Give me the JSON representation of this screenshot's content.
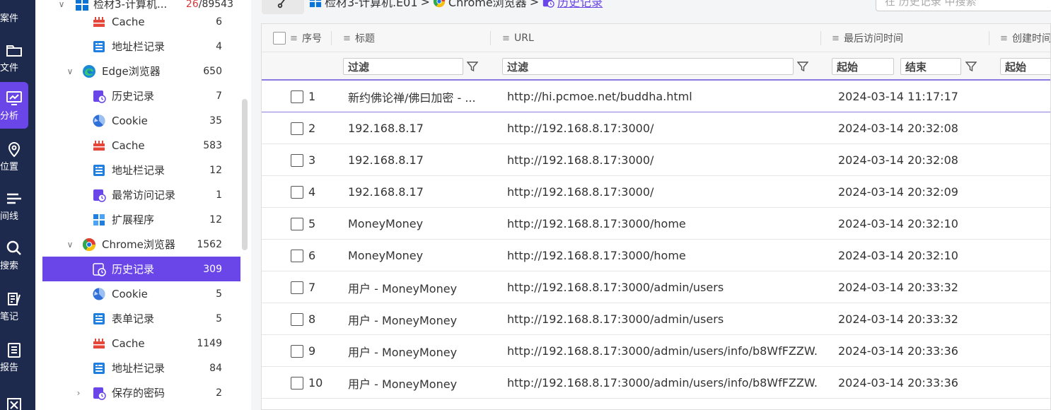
{
  "rail": {
    "items": [
      {
        "label": "案件",
        "icon": "case-icon"
      },
      {
        "label": "文件",
        "icon": "folder-icon"
      },
      {
        "label": "分析",
        "icon": "analysis-icon",
        "active": true
      },
      {
        "label": "位置",
        "icon": "location-icon"
      },
      {
        "label": "间线",
        "icon": "timeline-icon"
      },
      {
        "label": "搜索",
        "icon": "search-icon"
      },
      {
        "label": "笔记",
        "icon": "note-icon"
      },
      {
        "label": "报告",
        "icon": "report-icon"
      },
      {
        "label": "",
        "icon": "tool-icon"
      }
    ]
  },
  "tree": {
    "root": {
      "label": "检材3-计算机...",
      "count_a": "26",
      "count_b": "/89543"
    },
    "items": [
      {
        "label": "Cache",
        "count": "6",
        "icon": "cache-icon",
        "level": 2
      },
      {
        "label": "地址栏记录",
        "count": "4",
        "icon": "addressbar-icon",
        "level": 2
      },
      {
        "label": "Edge浏览器",
        "count": "650",
        "icon": "edge-icon",
        "level": 1,
        "expanded": true
      },
      {
        "label": "历史记录",
        "count": "7",
        "icon": "history-icon",
        "level": 2
      },
      {
        "label": "Cookie",
        "count": "35",
        "icon": "cookie-icon",
        "level": 2
      },
      {
        "label": "Cache",
        "count": "583",
        "icon": "cache-icon",
        "level": 2
      },
      {
        "label": "地址栏记录",
        "count": "12",
        "icon": "addressbar-icon",
        "level": 2
      },
      {
        "label": "最常访问记录",
        "count": "1",
        "icon": "history-icon",
        "level": 2
      },
      {
        "label": "扩展程序",
        "count": "12",
        "icon": "extension-icon",
        "level": 2
      },
      {
        "label": "Chrome浏览器",
        "count": "1562",
        "icon": "chrome-icon",
        "level": 1,
        "expanded": true
      },
      {
        "label": "历史记录",
        "count": "309",
        "icon": "history-icon",
        "level": 2,
        "selected": true
      },
      {
        "label": "Cookie",
        "count": "5",
        "icon": "cookie-icon",
        "level": 2
      },
      {
        "label": "表单记录",
        "count": "5",
        "icon": "addressbar-icon",
        "level": 2
      },
      {
        "label": "Cache",
        "count": "1149",
        "icon": "cache-icon",
        "level": 2
      },
      {
        "label": "地址栏记录",
        "count": "84",
        "icon": "addressbar-icon",
        "level": 2
      },
      {
        "label": "保存的密码",
        "count": "2",
        "icon": "history-icon",
        "level": 2,
        "collapsed": true
      }
    ]
  },
  "breadcrumb": {
    "part1": "检材3-计算机.E01",
    "sep": ">",
    "part2": "Chrome浏览器",
    "part3": "历史记录"
  },
  "search": {
    "placeholder": "在 历史记录 中搜索"
  },
  "columns": {
    "index": "序号",
    "title": "标题",
    "url": "URL",
    "last_visit": "最后访问时间",
    "created": "创建时间"
  },
  "filters": {
    "title": "过滤",
    "url": "过滤",
    "start": "起始",
    "end": "结束",
    "created_start": "起始"
  },
  "rows": [
    {
      "index": "1",
      "title": "新约佛论禅/佛曰加密 - ...",
      "url": "http://hi.pcmoe.net/buddha.html",
      "time": "2024-03-14 11:17:17"
    },
    {
      "index": "2",
      "title": "192.168.8.17",
      "url": "http://192.168.8.17:3000/",
      "time": "2024-03-14 20:32:08"
    },
    {
      "index": "3",
      "title": "192.168.8.17",
      "url": "http://192.168.8.17:3000/",
      "time": "2024-03-14 20:32:08"
    },
    {
      "index": "4",
      "title": "192.168.8.17",
      "url": "http://192.168.8.17:3000/",
      "time": "2024-03-14 20:32:09"
    },
    {
      "index": "5",
      "title": "MoneyMoney",
      "url": "http://192.168.8.17:3000/home",
      "time": "2024-03-14 20:32:10"
    },
    {
      "index": "6",
      "title": "MoneyMoney",
      "url": "http://192.168.8.17:3000/home",
      "time": "2024-03-14 20:32:10"
    },
    {
      "index": "7",
      "title": "用户 - MoneyMoney",
      "url": "http://192.168.8.17:3000/admin/users",
      "time": "2024-03-14 20:33:32"
    },
    {
      "index": "8",
      "title": "用户 - MoneyMoney",
      "url": "http://192.168.8.17:3000/admin/users",
      "time": "2024-03-14 20:33:32"
    },
    {
      "index": "9",
      "title": "用户 - MoneyMoney",
      "url": "http://192.168.8.17:3000/admin/users/info/b8WfFZZW...",
      "time": "2024-03-14 20:33:36"
    },
    {
      "index": "10",
      "title": "用户 - MoneyMoney",
      "url": "http://192.168.8.17:3000/admin/users/info/b8WfFZZW...",
      "time": "2024-03-14 20:33:36"
    }
  ],
  "colors": {
    "accent": "#6a46e8",
    "rail": "#1d2a4d"
  }
}
